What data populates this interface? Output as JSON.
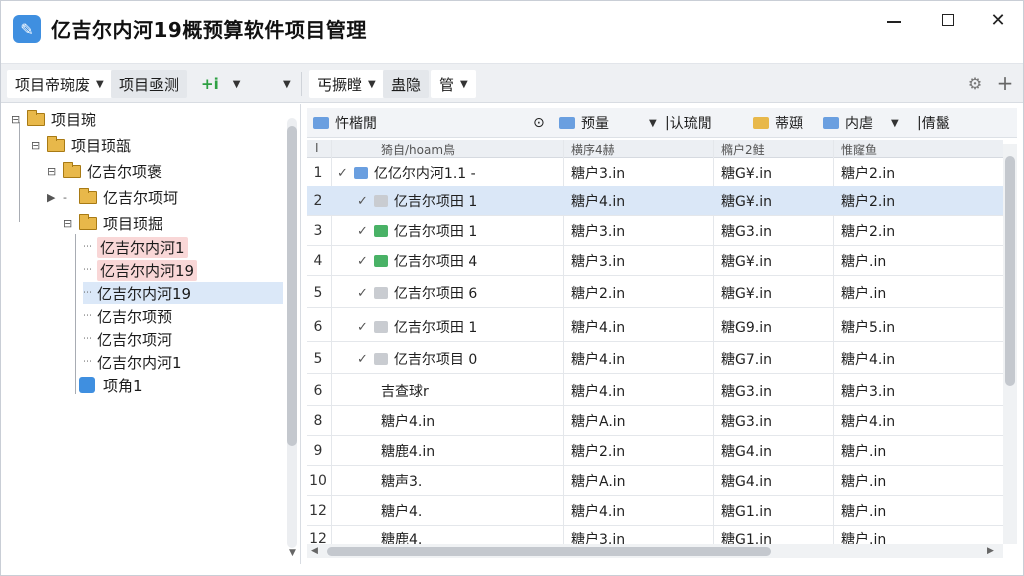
{
  "window": {
    "title": "亿吉尔内河19概预算软件项目管理",
    "icon_glyph": "✎",
    "icon_name": "app-logo-icon",
    "accent": "#3f8fe0"
  },
  "toolbar": {
    "tab1": "项目帝琬废",
    "tab2": "项目亟测",
    "add_label": "+i",
    "tab3": "丐撅瞠",
    "tab4": "蛊隐",
    "tab5": "管"
  },
  "tree": {
    "n1": "项目琬",
    "n2": "项目顼瓿",
    "n3": "亿吉尔项褒",
    "n4": "亿吉尔项坷",
    "n5": "项目顼掘",
    "n6": "亿吉尔内河1",
    "n7": "亿吉尔内河19",
    "n8": "亿吉尔内河19",
    "n9": "亿吉尔项预",
    "n10": "亿吉尔项河",
    "n11": "亿吉尔内河1",
    "n12": "项角1"
  },
  "grid_toolbar": {
    "i1": "忤楷閒",
    "i2": "预量",
    "i3": "认琉閒",
    "i4": "蒂頲",
    "i5": "内虐",
    "i6": "倩鬣"
  },
  "grid_header": {
    "c0": "I",
    "c1": "猗自/hoam鳥",
    "c2": "横序4赫",
    "c3": "橢户2鲑",
    "c4": "惟窿鱼"
  },
  "rows": [
    {
      "num": "1",
      "name": "亿亿尔内河1.1 -",
      "c2": "糖户3.in",
      "c3": "糖G¥.in",
      "c4": "糖户2.in"
    },
    {
      "num": "2",
      "name": "亿吉尔项田 1",
      "c2": "糖户4.in",
      "c3": "糖G¥.in",
      "c4": "糖户2.in"
    },
    {
      "num": "3",
      "name": "亿吉尔项田 1",
      "c2": "糖户3.in",
      "c3": "糖G3.in",
      "c4": "糖户2.in"
    },
    {
      "num": "4",
      "name": "亿吉尔项田 4",
      "c2": "糖户3.in",
      "c3": "糖G¥.in",
      "c4": "糖户.in"
    },
    {
      "num": "5",
      "name": "亿吉尔项田 6",
      "c2": "糖户2.in",
      "c3": "糖G¥.in",
      "c4": "糖户.in"
    },
    {
      "num": "6",
      "name": "亿吉尔项田 1",
      "c2": "糖户4.in",
      "c3": "糖G9.in",
      "c4": "糖户5.in"
    },
    {
      "num": "5",
      "name": "亿吉尔项目 0",
      "c2": "糖户4.in",
      "c3": "糖G7.in",
      "c4": "糖户4.in"
    },
    {
      "num": "6",
      "name": "吉查球r",
      "c2": "糖户4.in",
      "c3": "糖G3.in",
      "c4": "糖户3.in"
    },
    {
      "num": "8",
      "name": "糖户4.in",
      "c2": "糖户A.in",
      "c3": "糖G3.in",
      "c4": "糖户4.in"
    },
    {
      "num": "9",
      "name": "糖鹿4.in",
      "c2": "糖户2.in",
      "c3": "糖G4.in",
      "c4": "糖户.in"
    },
    {
      "num": "10",
      "name": "糖声3.",
      "c2": "糖户A.in",
      "c3": "糖G4.in",
      "c4": "糖户.in"
    },
    {
      "num": "12",
      "name": "糖户4.",
      "c2": "糖户4.in",
      "c3": "糖G1.in",
      "c4": "糖户.in"
    },
    {
      "num": "12",
      "name": "糖鹿4.",
      "c2": "糖户3.in",
      "c3": "糖G1.in",
      "c4": "糖户.in"
    }
  ]
}
